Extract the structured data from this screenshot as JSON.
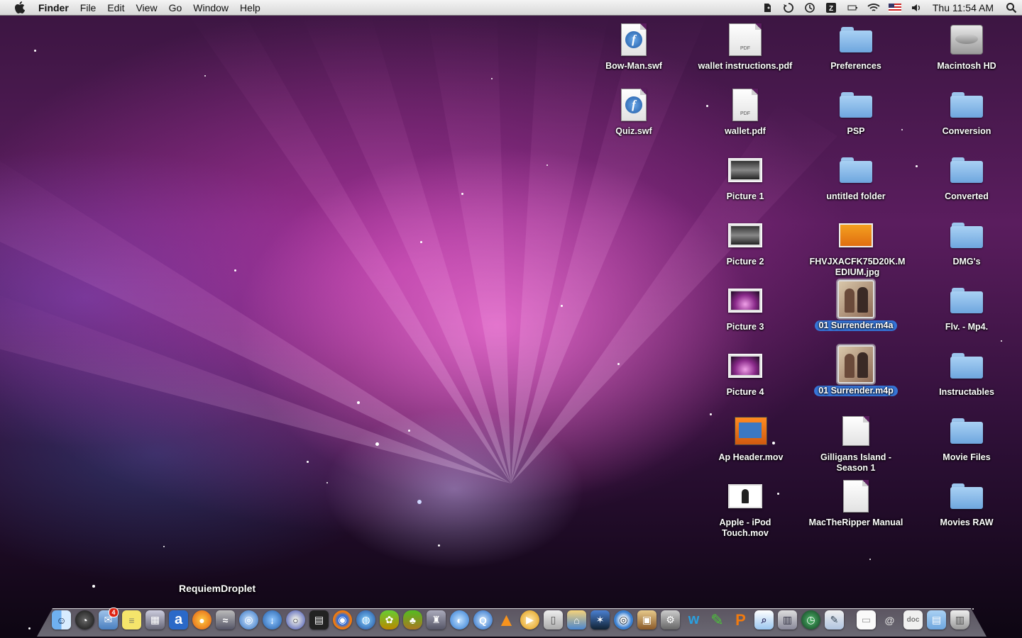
{
  "menubar": {
    "app_name": "Finder",
    "menus": [
      "File",
      "Edit",
      "View",
      "Go",
      "Window",
      "Help"
    ],
    "clock": "Thu 11:54 AM",
    "status_icons": [
      "evernote-icon",
      "sync-icon",
      "time-machine-icon",
      "app-icon",
      "battery-icon",
      "wifi-icon",
      "flag-icon",
      "volume-icon"
    ]
  },
  "desktop_icons": [
    {
      "label": "Bow-Man.swf",
      "kind": "swf"
    },
    {
      "label": "Quiz.swf",
      "kind": "swf"
    },
    {
      "label": "wallet instructions.pdf",
      "kind": "pdf"
    },
    {
      "label": "wallet.pdf",
      "kind": "pdf"
    },
    {
      "label": "Picture 1",
      "kind": "screenshot"
    },
    {
      "label": "Picture 2",
      "kind": "screenshot"
    },
    {
      "label": "Picture 3",
      "kind": "galaxy"
    },
    {
      "label": "Picture 4",
      "kind": "galaxy"
    },
    {
      "label": "Ap Header.mov",
      "kind": "movie"
    },
    {
      "label": "Apple - iPod Touch.mov",
      "kind": "ipodmovie"
    },
    {
      "label": "Preferences",
      "kind": "folder"
    },
    {
      "label": "PSP",
      "kind": "folder"
    },
    {
      "label": "untitled folder",
      "kind": "folder"
    },
    {
      "label": "FHVJXACFK75D20K.MEDIUM.jpg",
      "kind": "jpg"
    },
    {
      "label": "01 Surrender.m4a",
      "kind": "album",
      "selected": true
    },
    {
      "label": "01 Surrender.m4p",
      "kind": "album",
      "selected": true
    },
    {
      "label": "Gilligans Island - Season 1",
      "kind": "disk"
    },
    {
      "label": "MacTheRipper Manual",
      "kind": "document"
    },
    {
      "label": "Macintosh HD",
      "kind": "harddisk"
    },
    {
      "label": "Conversion",
      "kind": "folder"
    },
    {
      "label": "Converted",
      "kind": "folder"
    },
    {
      "label": "DMG's",
      "kind": "folder"
    },
    {
      "label": "Flv. - Mp4.",
      "kind": "folder"
    },
    {
      "label": "Instructables",
      "kind": "folder"
    },
    {
      "label": "Movie Files",
      "kind": "folder"
    },
    {
      "label": "Movies RAW",
      "kind": "folder"
    }
  ],
  "dock": {
    "tooltip": "RequiemDroplet",
    "mail_badge": "4",
    "items": [
      "finder-icon",
      "dashboard-icon",
      "mail-icon",
      "stickies-icon",
      "expose-icon",
      "amazon-icon",
      "burn-icon",
      "unknown-icon",
      "itunes-helper-icon",
      "download-icon",
      "opera-icon",
      "clapboard-icon",
      "firefox-icon",
      "globe-icon",
      "pineapple-icon",
      "palm-icon",
      "robot-icon",
      "ichat-icon",
      "quicktime-icon",
      "vlc-icon",
      "play-icon",
      "ipod-icon",
      "iphoto-icon",
      "imovie-icon",
      "dvd-player-icon",
      "photo-booth-icon",
      "system-preferences-icon",
      "wacom-icon",
      "green-app-icon",
      "pages-icon",
      "preview-icon",
      "network-icon",
      "time-machine-icon",
      "pictures-icon",
      "document-icon",
      "download-stack-icon",
      "document-stack-icon",
      "applications-icon",
      "trash-icon"
    ]
  }
}
